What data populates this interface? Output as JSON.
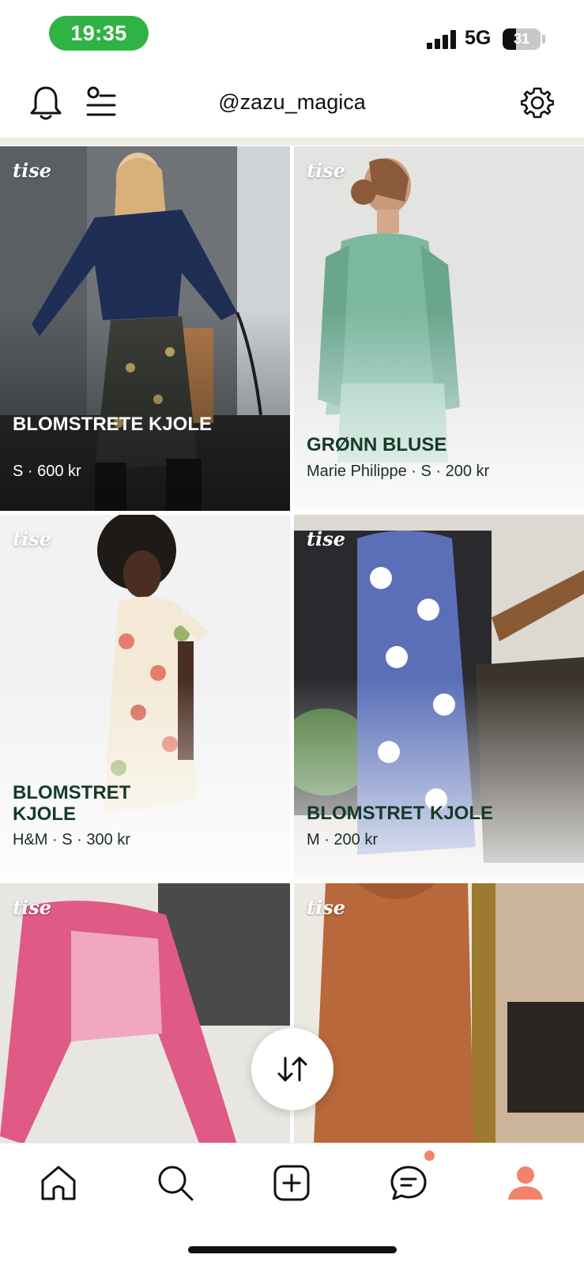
{
  "status_bar": {
    "time": "19:35",
    "network": "5G",
    "battery_level": "31",
    "battery_fraction": 0.31,
    "time_pill_color": "#2fb344"
  },
  "header": {
    "username": "@zazu_magica",
    "icons": [
      "bell-icon",
      "filter-list-icon",
      "gear-icon"
    ]
  },
  "brand_badge": "tise",
  "listings": [
    {
      "title": "BLOMSTRETE KJOLE",
      "meta": "S · 600 kr",
      "text_style": "light"
    },
    {
      "title": "GRØNN BLUSE",
      "meta": "Marie Philippe · S · 200 kr",
      "text_style": "dark"
    },
    {
      "title": "BLOMSTRET KJOLE",
      "meta": "H&M · S · 300 kr",
      "text_style": "dark"
    },
    {
      "title": "BLOMSTRET KJOLE",
      "meta": "M · 200 kr",
      "text_style": "dark"
    },
    {
      "title": "",
      "meta": "",
      "text_style": "light"
    },
    {
      "title": "",
      "meta": "",
      "text_style": "light"
    }
  ],
  "sort_button": {
    "icon": "sort-arrows-icon"
  },
  "bottom_nav": {
    "items": [
      {
        "icon": "home-icon"
      },
      {
        "icon": "search-icon"
      },
      {
        "icon": "add-listing-icon"
      },
      {
        "icon": "messages-icon",
        "has_notification": true
      },
      {
        "icon": "profile-icon",
        "active": true
      }
    ],
    "active_color": "#f4826b"
  }
}
